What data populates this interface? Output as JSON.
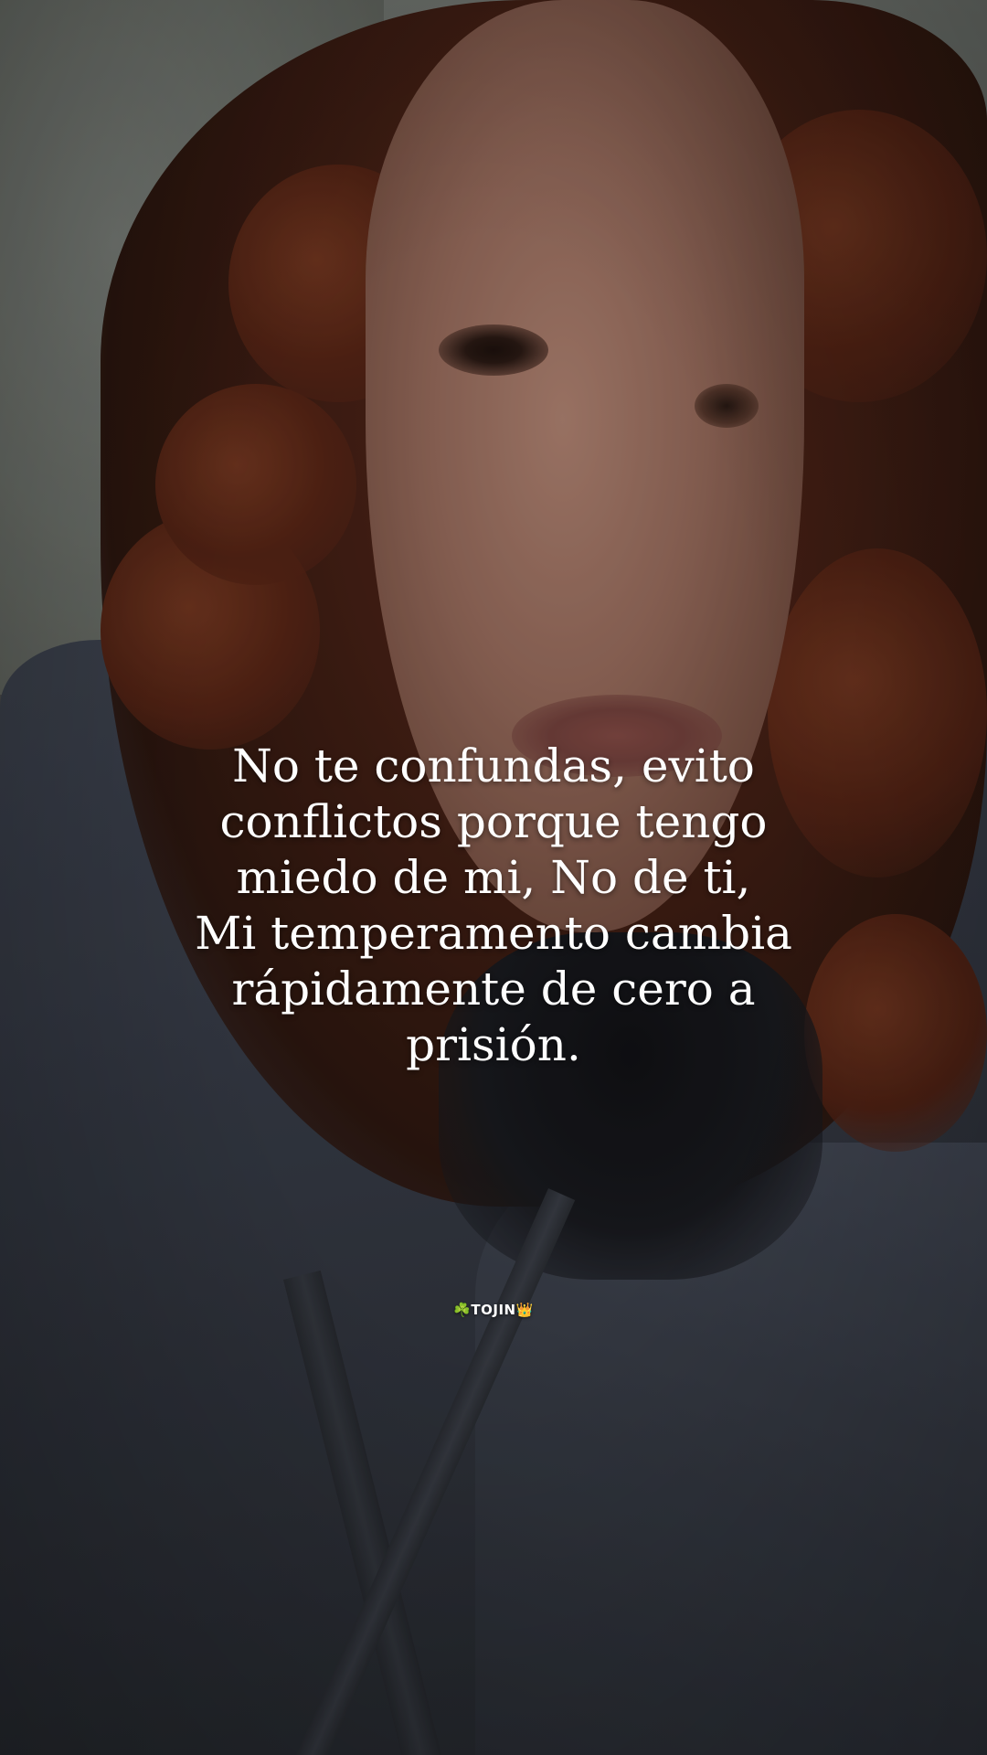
{
  "quote": {
    "lines": [
      "No te confundas, evito",
      "conflictos porque tengo",
      "miedo de mi, No de ti,",
      "Mi temperamento cambia",
      "rápidamente de cero a",
      "prisión."
    ]
  },
  "watermark": {
    "text": "☘️TOJIN👑"
  }
}
